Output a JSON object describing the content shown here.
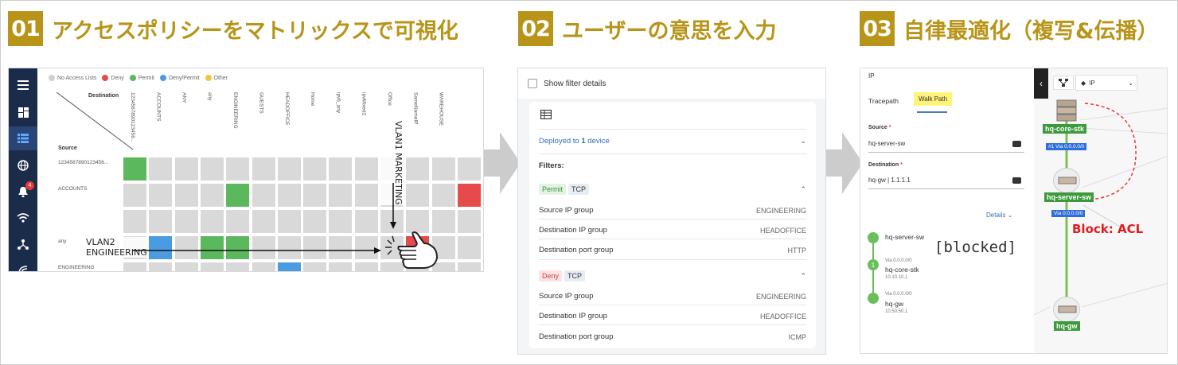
{
  "steps": [
    {
      "num": "01",
      "title": "アクセスポリシーをマトリックスで可視化"
    },
    {
      "num": "02",
      "title": "ユーザーの意思を入力"
    },
    {
      "num": "03",
      "title": "自律最適化（複写&伝播）"
    }
  ],
  "colors": {
    "accent": "#b89418",
    "permit": "#5cb85c",
    "deny": "#e64a4a",
    "deny_permit": "#4a9be0",
    "other": "#f5c542",
    "none": "#d9d9d9",
    "arrow": "#cccccc"
  },
  "matrix": {
    "legend": [
      {
        "label": "No Access Lists",
        "color": "#d0d0d0"
      },
      {
        "label": "Deny",
        "color": "#e64a4a"
      },
      {
        "label": "Permit",
        "color": "#5cb85c"
      },
      {
        "label": "Deny/Permit",
        "color": "#4a9be0"
      },
      {
        "label": "Other",
        "color": "#f5c542"
      }
    ],
    "dest_label": "Destination",
    "src_label": "Source",
    "columns": [
      "1234567890123456...",
      "ACCOUNTS",
      "ANY",
      "any",
      "ENGINEERING",
      "GUESTS",
      "HEADOFFICE",
      "Home",
      "ipv6_any",
      "ipvMixed2",
      "Office",
      "SameNameIP",
      "WAREHOUSE"
    ],
    "rows": [
      "1234567890123456...",
      "ACCOUNTS",
      "",
      "any",
      "ENGINEERING"
    ],
    "vlan1": "VLAN1 MARKETING",
    "vlan2_line1": "VLAN2",
    "vlan2_line2": "ENGINEERING",
    "sidebar_icons": [
      "menu-icon",
      "dashboard-icon",
      "list-icon",
      "globe-icon",
      "alert-icon",
      "wifi-icon",
      "topology-icon",
      "signal-icon"
    ],
    "alert_count": "4"
  },
  "filter_panel": {
    "show_filter_details": "Show filter details",
    "deployed_prefix": "Deployed to",
    "deployed_count": "1",
    "deployed_suffix": "device",
    "filters_label": "Filters:",
    "rules": [
      {
        "action": "Permit",
        "protocol": "TCP",
        "rows": [
          {
            "label": "Source IP group",
            "value": "ENGINEERING"
          },
          {
            "label": "Destination IP group",
            "value": "HEADOFFICE"
          },
          {
            "label": "Destination port group",
            "value": "HTTP"
          }
        ]
      },
      {
        "action": "Deny",
        "protocol": "TCP",
        "rows": [
          {
            "label": "Source IP group",
            "value": "ENGINEERING"
          },
          {
            "label": "Destination IP group",
            "value": "HEADOFFICE"
          },
          {
            "label": "Destination port group",
            "value": "ICMP"
          }
        ]
      }
    ]
  },
  "walk_path": {
    "header": "IP",
    "tab_tracepath": "Tracepath",
    "tab_walkpath": "Walk Path",
    "source_label": "Source",
    "source_value": "hq-server-sw",
    "destination_label": "Destination",
    "destination_value": "hq-gw | 1.1.1.1",
    "details_label": "Details",
    "blocked": "[blocked]",
    "hops": [
      {
        "name": "hq-server-sw",
        "via": "",
        "ip": ""
      },
      {
        "name": "hq-core-stk",
        "via": "Via 0.0.0.0/0",
        "ip": "10.10.10.1",
        "badge": "1"
      },
      {
        "name": "hq-gw",
        "via": "Via 0.0.0.0/0",
        "ip": "10.50.50.1"
      }
    ],
    "ip_select": "IP",
    "topology": {
      "core_label": "hq-core-stk",
      "core_via": "#1 Via 0.0.0.0/0",
      "server_label": "hq-server-sw",
      "server_via": "Via 0.0.0.0/0",
      "gw_label": "hq-gw",
      "block_label": "Block: ACL"
    }
  }
}
